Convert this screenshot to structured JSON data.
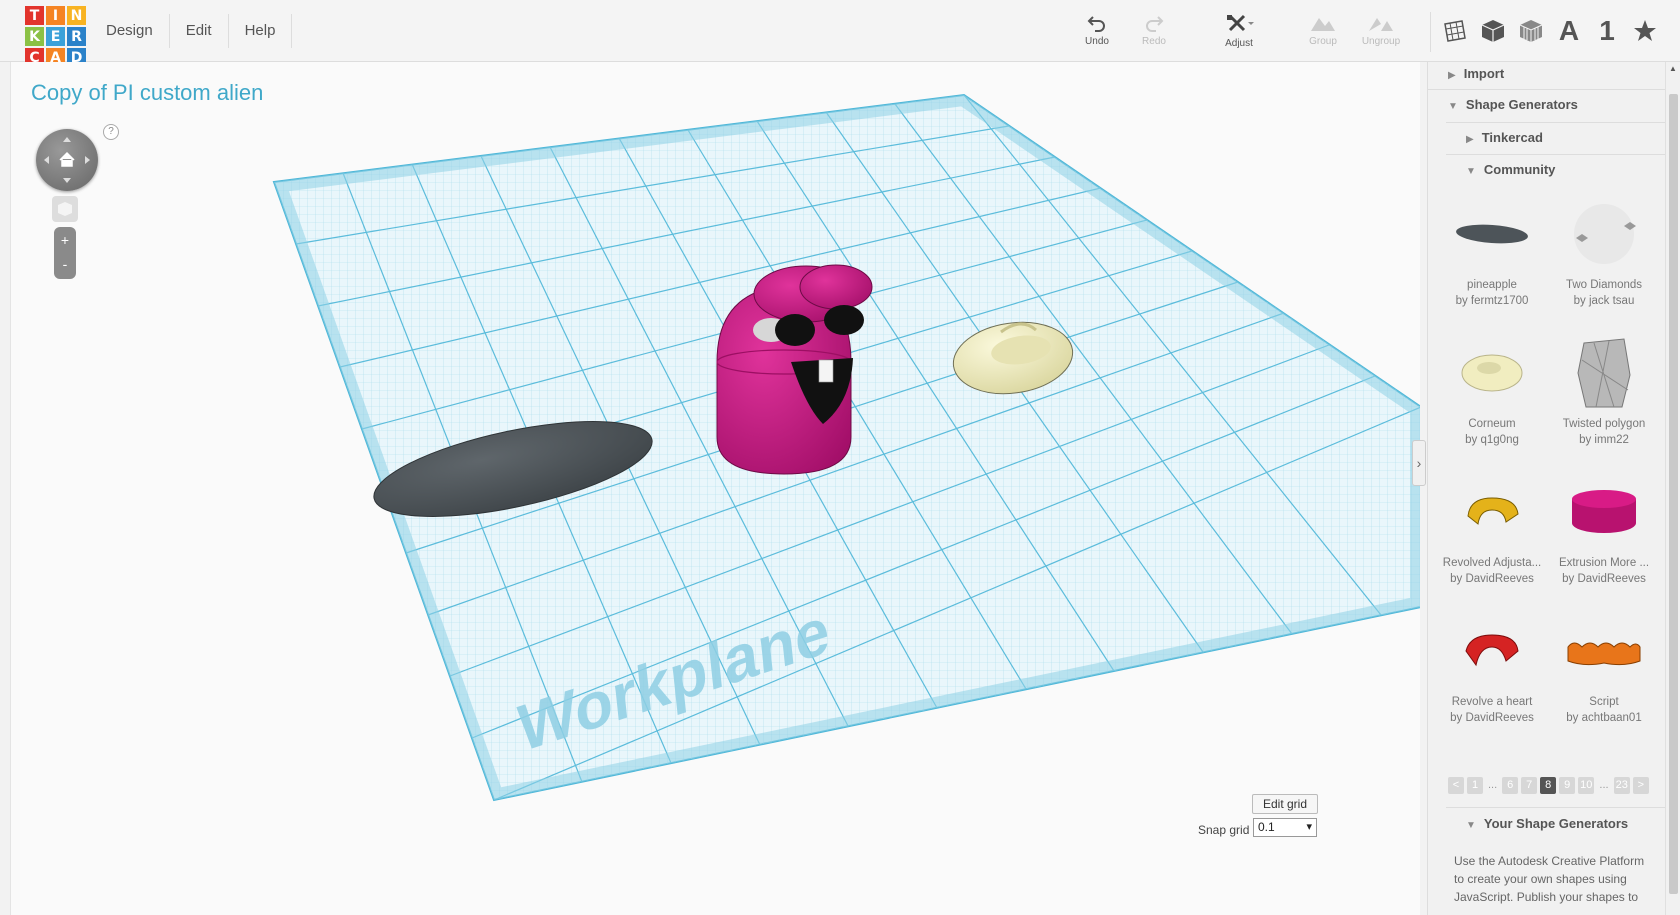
{
  "logo": {
    "letters": [
      "T",
      "I",
      "N",
      "K",
      "E",
      "R",
      "C",
      "A",
      "D"
    ],
    "colors": [
      "#e2342c",
      "#f58423",
      "#f8b322",
      "#8bc145",
      "#3ba1d9",
      "#2b82c9",
      "#e2342c",
      "#f58423",
      "#2b82c9"
    ]
  },
  "menu": {
    "items": [
      "Design",
      "Edit",
      "Help"
    ]
  },
  "toolbar": {
    "undo": "Undo",
    "redo": "Redo",
    "adjust": "Adjust",
    "group": "Group",
    "ungroup": "Ungroup"
  },
  "view_buttons": {
    "text_label": "A",
    "number_label": "1"
  },
  "canvas": {
    "title": "Copy of PI custom alien",
    "help": "?",
    "zoom_in": "+",
    "zoom_out": "-",
    "workplane_label": "Workplane",
    "edit_grid": "Edit grid",
    "snap_label": "Snap grid",
    "snap_value": "0.1",
    "collapse": "›"
  },
  "sidebar": {
    "import": "Import",
    "shape_generators": "Shape Generators",
    "tinkercad": "Tinkercad",
    "community": "Community",
    "items": [
      {
        "name": "pineapple",
        "by": "by fermtz1700"
      },
      {
        "name": "Two Diamonds",
        "by": "by jack tsau"
      },
      {
        "name": "Corneum",
        "by": "by q1g0ng"
      },
      {
        "name": "Twisted polygon",
        "by": "by imm22"
      },
      {
        "name": "Revolved Adjusta...",
        "by": "by DavidReeves"
      },
      {
        "name": "Extrusion More ...",
        "by": "by DavidReeves"
      },
      {
        "name": "Revolve a heart",
        "by": "by DavidReeves"
      },
      {
        "name": "Script",
        "by": "by achtbaan01"
      }
    ],
    "pager": [
      "<",
      "1",
      "...",
      "6",
      "7",
      "8",
      "9",
      "10",
      "...",
      "23",
      ">"
    ],
    "current_page": "8",
    "your_shape_generators": "Your Shape Generators",
    "your_text": "Use the Autodesk Creative Platform to create your own shapes using JavaScript. Publish your shapes to"
  },
  "colors": {
    "accent": "#3fa8c9",
    "grid": "#7cc8e0",
    "alien": "#c0127d",
    "grey_shape": "#4d5459",
    "cream_shape": "#f3f0c4"
  }
}
